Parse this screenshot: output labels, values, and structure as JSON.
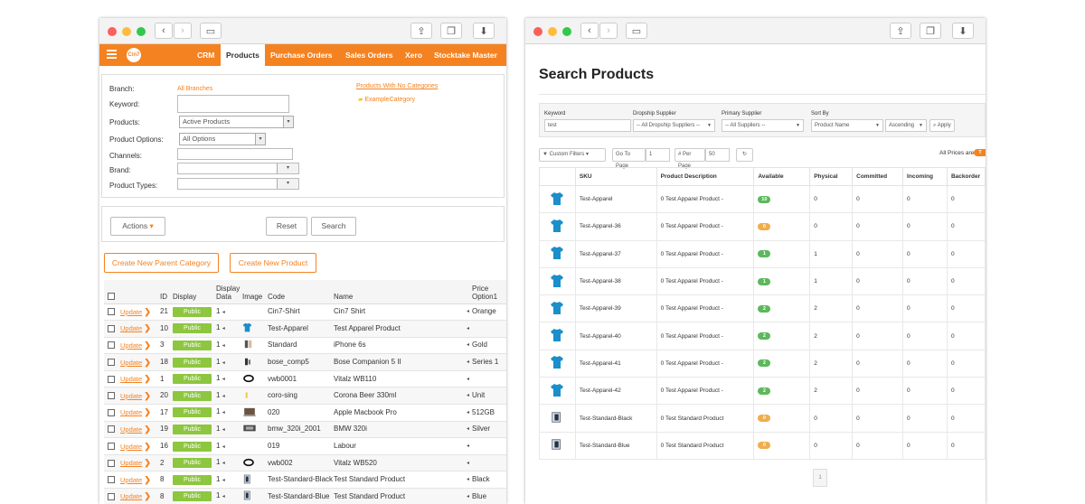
{
  "left_window": {
    "nav": {
      "logo_text": "Cin7",
      "items": [
        "CRM",
        "Products",
        "Purchase Orders",
        "Sales Orders",
        "Xero",
        "Stocktake Master"
      ],
      "active": "Products"
    },
    "filters": {
      "branch_label": "Branch:",
      "branch_value": "All Branches",
      "keyword_label": "Keyword:",
      "products_label": "Products:",
      "products_value": "Active Products",
      "options_label": "Product Options:",
      "options_value": "All Options",
      "channels_label": "Channels:",
      "brand_label": "Brand:",
      "types_label": "Product Types:",
      "no_categories_link": "Products With No Categories",
      "category_example": "ExampleCategory"
    },
    "actions_button": "Actions",
    "reset_button": "Reset",
    "search_button": "Search",
    "create_parent_category": "Create New Parent Category",
    "create_product": "Create New Product",
    "table": {
      "columns": [
        "",
        "",
        "ID",
        "Display",
        "Display Data",
        "Image",
        "Code",
        "Name",
        "Price Option1"
      ],
      "update_label": "Update",
      "rows": [
        {
          "id": "21",
          "display": "Public",
          "data": "1",
          "img": "none",
          "code": "Cin7-Shirt",
          "name": "Cin7 Shirt",
          "price": "Orange"
        },
        {
          "id": "10",
          "display": "Public",
          "data": "1",
          "img": "shirt",
          "code": "Test-Apparel",
          "name": "Test Apparel Product",
          "price": ""
        },
        {
          "id": "3",
          "display": "Public",
          "data": "1",
          "img": "phone",
          "code": "Standard",
          "name": "iPhone 6s",
          "price": "Gold"
        },
        {
          "id": "18",
          "display": "Public",
          "data": "1",
          "img": "headphones",
          "code": "bose_comp5",
          "name": "Bose Companion 5 II",
          "price": "Series 1"
        },
        {
          "id": "1",
          "display": "Public",
          "data": "1",
          "img": "band",
          "code": "vwb0001",
          "name": "Vitalz WB110",
          "price": ""
        },
        {
          "id": "20",
          "display": "Public",
          "data": "1",
          "img": "beer",
          "code": "coro-sing",
          "name": "Corona Beer 330ml",
          "price": "Unit"
        },
        {
          "id": "17",
          "display": "Public",
          "data": "1",
          "img": "laptop",
          "code": "020",
          "name": "Apple Macbook Pro",
          "price": "512GB"
        },
        {
          "id": "19",
          "display": "Public",
          "data": "1",
          "img": "car",
          "code": "bmw_320i_2001",
          "name": "BMW 320i",
          "price": "Silver"
        },
        {
          "id": "16",
          "display": "Public",
          "data": "1",
          "img": "none",
          "code": "019",
          "name": "Labour",
          "price": ""
        },
        {
          "id": "2",
          "display": "Public",
          "data": "1",
          "img": "band",
          "code": "vwb002",
          "name": "Vitalz WB520",
          "price": ""
        },
        {
          "id": "8",
          "display": "Public",
          "data": "1",
          "img": "phonebox",
          "code": "Test-Standard-Black",
          "name": "Test Standard Product",
          "price": "Black"
        },
        {
          "id": "8",
          "display": "Public",
          "data": "1",
          "img": "phonebox",
          "code": "Test-Standard-Blue",
          "name": "Test Standard Product",
          "price": "Blue"
        }
      ]
    }
  },
  "right_window": {
    "title": "Search Products",
    "filters": {
      "keyword_label": "Keyword",
      "keyword_value": "test",
      "dropship_label": "Dropship Supplier",
      "dropship_value": "-- All Dropship Suppliers --",
      "primary_label": "Primary Supplier",
      "primary_value": "-- All Suppliers --",
      "sort_label": "Sort By",
      "sort_value": "Product Name",
      "sort_dir": "Ascending",
      "apply": "Apply"
    },
    "custom_filters": "Custom Filters",
    "go_to_page_label": "Go To Page",
    "go_to_page_value": "1",
    "per_page_label": "# Per Page",
    "per_page_value": "50",
    "all_prices_label": "All Prices are",
    "all_prices_badge": "T",
    "table": {
      "columns": [
        "",
        "SKU",
        "Product Description",
        "Available",
        "Physical",
        "Committed",
        "Incoming",
        "Backorder"
      ],
      "rows": [
        {
          "img": "shirt",
          "sku": "Test-Apparel",
          "desc": "0 Test Apparel Product -",
          "avail": "10",
          "color": "green",
          "physical": "0",
          "committed": "0",
          "incoming": "0",
          "backorder": "0"
        },
        {
          "img": "shirt",
          "sku": "Test-Apparel-36",
          "desc": "0 Test Apparel Product -",
          "avail": "0",
          "color": "orange",
          "physical": "0",
          "committed": "0",
          "incoming": "0",
          "backorder": "0"
        },
        {
          "img": "shirt",
          "sku": "Test-Apparel-37",
          "desc": "0 Test Apparel Product -",
          "avail": "1",
          "color": "green",
          "physical": "1",
          "committed": "0",
          "incoming": "0",
          "backorder": "0"
        },
        {
          "img": "shirt",
          "sku": "Test-Apparel-38",
          "desc": "0 Test Apparel Product -",
          "avail": "1",
          "color": "green",
          "physical": "1",
          "committed": "0",
          "incoming": "0",
          "backorder": "0"
        },
        {
          "img": "shirt",
          "sku": "Test-Apparel-39",
          "desc": "0 Test Apparel Product -",
          "avail": "2",
          "color": "green",
          "physical": "2",
          "committed": "0",
          "incoming": "0",
          "backorder": "0"
        },
        {
          "img": "shirt",
          "sku": "Test-Apparel-40",
          "desc": "0 Test Apparel Product -",
          "avail": "2",
          "color": "green",
          "physical": "2",
          "committed": "0",
          "incoming": "0",
          "backorder": "0"
        },
        {
          "img": "shirt",
          "sku": "Test-Apparel-41",
          "desc": "0 Test Apparel Product -",
          "avail": "2",
          "color": "green",
          "physical": "2",
          "committed": "0",
          "incoming": "0",
          "backorder": "0"
        },
        {
          "img": "shirt",
          "sku": "Test-Apparel-42",
          "desc": "0 Test Apparel Product -",
          "avail": "2",
          "color": "green",
          "physical": "2",
          "committed": "0",
          "incoming": "0",
          "backorder": "0"
        },
        {
          "img": "phonebox",
          "sku": "Test-Standard-Black",
          "desc": "0 Test Standard Product",
          "avail": "0",
          "color": "orange",
          "physical": "0",
          "committed": "0",
          "incoming": "0",
          "backorder": "0"
        },
        {
          "img": "phonebox",
          "sku": "Test-Standard-Blue",
          "desc": "0 Test Standard Product",
          "avail": "0",
          "color": "orange",
          "physical": "0",
          "committed": "0",
          "incoming": "0",
          "backorder": "0"
        }
      ]
    },
    "pagination_current": "1"
  },
  "colors": {
    "accent": "#f58220",
    "public": "#8dc63f",
    "link_blue": "#2a8ad6",
    "shirt": "#1a8fc9"
  }
}
